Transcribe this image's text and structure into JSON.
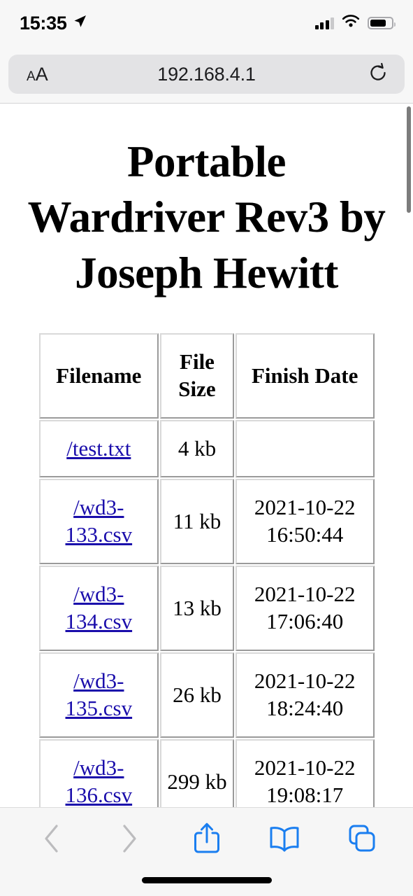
{
  "status_bar": {
    "time": "15:35",
    "location_icon": "location-arrow-icon",
    "signal_icon": "cellular-signal-icon",
    "wifi_icon": "wifi-icon",
    "battery_icon": "battery-icon"
  },
  "browser": {
    "text_size_label_small": "A",
    "text_size_label_large": "A",
    "url": "192.168.4.1",
    "reload_icon": "reload-icon"
  },
  "page": {
    "title": "Portable Wardriver Rev3 by Joseph Hewitt",
    "table": {
      "headers": [
        "Filename",
        "File Size",
        "Finish Date"
      ],
      "rows": [
        {
          "filename": "/test.txt",
          "size": "4 kb",
          "date": ""
        },
        {
          "filename": "/wd3-133.csv",
          "size": "11 kb",
          "date": "2021-10-22 16:50:44"
        },
        {
          "filename": "/wd3-134.csv",
          "size": "13 kb",
          "date": "2021-10-22 17:06:40"
        },
        {
          "filename": "/wd3-135.csv",
          "size": "26 kb",
          "date": "2021-10-22 18:24:40"
        },
        {
          "filename": "/wd3-136.csv",
          "size": "299 kb",
          "date": "2021-10-22 19:08:17"
        }
      ]
    },
    "link_color": "#1a0dab"
  },
  "toolbar": {
    "back_icon": "chevron-left-icon",
    "forward_icon": "chevron-right-icon",
    "share_icon": "share-icon",
    "bookmarks_icon": "book-icon",
    "tabs_icon": "tabs-icon",
    "accent_color": "#1a7ef0",
    "disabled_color": "#bcbcbe"
  }
}
